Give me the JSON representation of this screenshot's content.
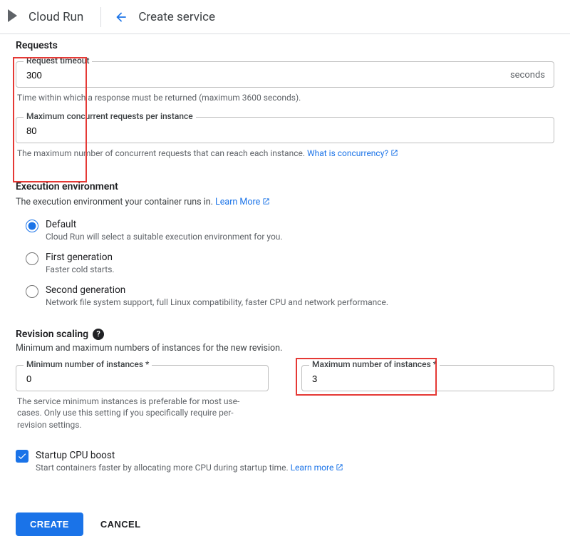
{
  "header": {
    "product_name": "Cloud Run",
    "page_title": "Create service"
  },
  "requests": {
    "heading": "Requests",
    "timeout_label": "Request timeout",
    "timeout_value": "300",
    "timeout_suffix": "seconds",
    "timeout_helper": "Time within which a response must be returned (maximum 3600 seconds).",
    "concurrency_label": "Maximum concurrent requests per instance",
    "concurrency_value": "80",
    "concurrency_helper_prefix": "The maximum number of concurrent requests that can reach each instance. ",
    "concurrency_link": "What is concurrency?"
  },
  "exec_env": {
    "heading": "Execution environment",
    "sub": "The execution environment your container runs in. ",
    "learn_more": "Learn More",
    "options": [
      {
        "title": "Default",
        "desc": "Cloud Run will select a suitable execution environment for you.",
        "checked": true
      },
      {
        "title": "First generation",
        "desc": "Faster cold starts.",
        "checked": false
      },
      {
        "title": "Second generation",
        "desc": "Network file system support, full Linux compatibility, faster CPU and network performance.",
        "checked": false
      }
    ]
  },
  "scaling": {
    "heading": "Revision scaling",
    "sub": "Minimum and maximum numbers of instances for the new revision.",
    "min_label": "Minimum number of instances *",
    "min_value": "0",
    "min_helper": "The service minimum instances is preferable for most use-cases. Only use this setting if you specifically require per-revision settings.",
    "max_label": "Maximum number of instances *",
    "max_value": "3"
  },
  "cpu_boost": {
    "checked": true,
    "title": "Startup CPU boost",
    "desc_prefix": "Start containers faster by allocating more CPU during startup time. ",
    "learn_more": "Learn more"
  },
  "buttons": {
    "create": "CREATE",
    "cancel": "CANCEL"
  }
}
